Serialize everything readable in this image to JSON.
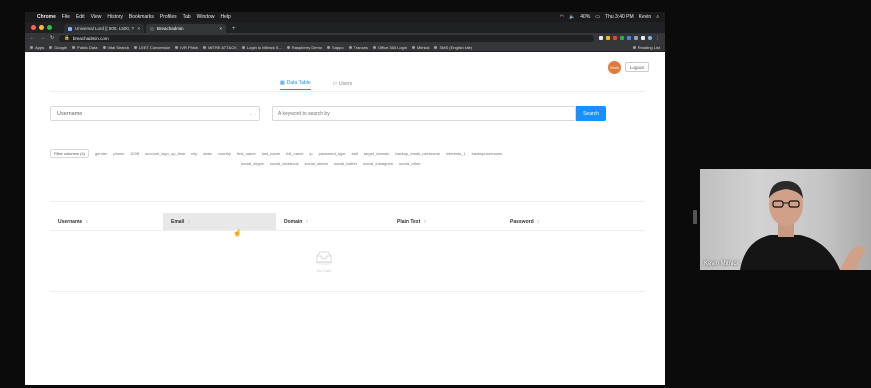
{
  "menubar": {
    "apple": "",
    "items": [
      "Chrome",
      "File",
      "Edit",
      "View",
      "History",
      "Bookmarks",
      "Profiles",
      "Tab",
      "Window",
      "Help"
    ],
    "battery": "40%",
    "clock": "Thu 3:40 PM",
    "user": "Kevin"
  },
  "browser": {
    "tabs": [
      {
        "label": "Universal Lord || 500, L500, ?",
        "active": false
      },
      {
        "label": "Breachadmin",
        "active": true
      }
    ],
    "url": "breachadmin.com",
    "bookmarks": [
      "Apps",
      "Google",
      "Public Data",
      "Vital Search",
      "LEET Conversion",
      "IVR Phish",
      "MITRE ATT&CK",
      "Login to Mitnick S...",
      "Raspberry Demo",
      "Sappo",
      "Trances",
      "Office 365 Login",
      "Mitnick",
      "SMS (English site)"
    ],
    "reading_list": "Reading List"
  },
  "app": {
    "avatar_text": "Kevin",
    "logout": "Logout",
    "tabs": [
      {
        "label": "Data Table",
        "icon": "table-icon",
        "active": true
      },
      {
        "label": "Users",
        "icon": "users-icon",
        "active": false
      }
    ],
    "field_select": {
      "value": "Username"
    },
    "search": {
      "placeholder": "A keyword to search by",
      "button": "Search"
    },
    "filter": {
      "tag": "Filter columns (4)",
      "columns_line1": [
        "gender",
        "phone",
        "DOB",
        "account_sign_up_time",
        "city",
        "state",
        "country",
        "first_name",
        "last_name",
        "full_name",
        "ip",
        "password_type",
        "salt",
        "target_domain",
        "backup_email_username",
        "interests_1",
        "backupusername"
      ],
      "columns_line2": [
        "social_skype",
        "social_facebook",
        "social_steam",
        "social_twitter",
        "social_instagram",
        "social_other"
      ]
    },
    "table": {
      "columns": [
        "Username",
        "Email",
        "Domain",
        "Plain Text",
        "Password"
      ],
      "empty_text": "No Data"
    }
  },
  "webcam": {
    "name": "Kevin Mitnick"
  },
  "colors": {
    "accent": "#1890ff",
    "avatar": "#e07a3d"
  }
}
